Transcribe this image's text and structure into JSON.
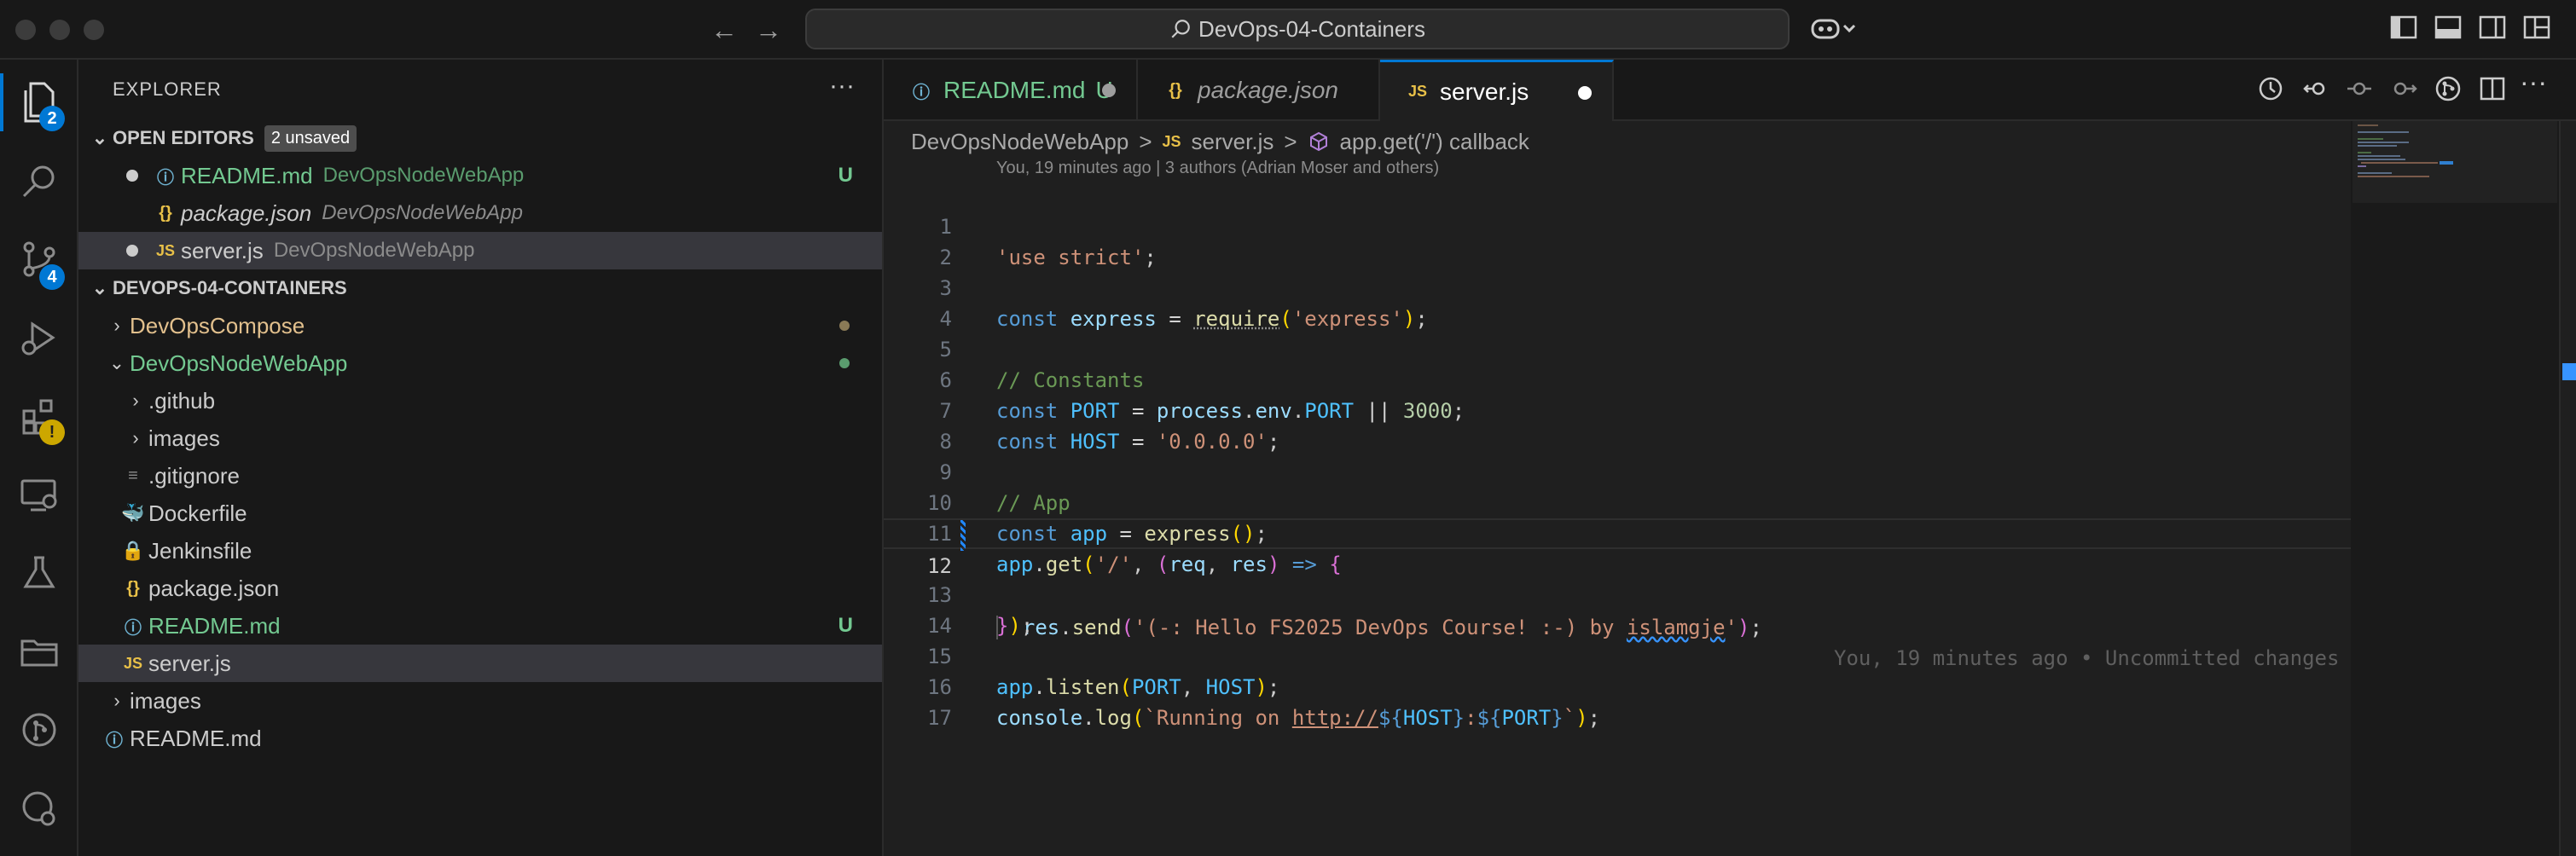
{
  "titlebar": {
    "search_text": "DevOps-04-Containers",
    "icons": [
      "back-arrow-icon",
      "forward-arrow-icon",
      "copilot-icon",
      "toggle-sidebar-icon",
      "toggle-panel-icon",
      "toggle-secondary-sidebar-icon",
      "customize-layout-icon"
    ]
  },
  "activity": {
    "explorer_badge": "2",
    "scm_badge": "4",
    "extensions_badge": "!"
  },
  "sidebar": {
    "title": "EXPLORER",
    "more": "···",
    "open_editors": {
      "label": "OPEN EDITORS",
      "badge": "2 unsaved",
      "items": [
        {
          "icon": "ⓘ",
          "name": "README.md",
          "desc": "DevOpsNodeWebApp",
          "flag": "U"
        },
        {
          "icon": "{}",
          "name": "package.json",
          "desc": "DevOpsNodeWebApp"
        },
        {
          "icon": "JS",
          "name": "server.js",
          "desc": "DevOpsNodeWebApp"
        }
      ]
    },
    "workspace": {
      "label": "DEVOPS-04-CONTAINERS",
      "items": [
        {
          "icon": "›",
          "name": "DevOpsCompose"
        },
        {
          "icon": "⌄",
          "name": "DevOpsNodeWebApp"
        },
        {
          "icon": "›",
          "name": ".github"
        },
        {
          "icon": "›",
          "name": "images"
        },
        {
          "icon": "≡",
          "name": ".gitignore"
        },
        {
          "icon": "🐳",
          "name": "Dockerfile"
        },
        {
          "icon": "🔒",
          "name": "Jenkinsfile"
        },
        {
          "icon": "{}",
          "name": "package.json"
        },
        {
          "icon": "ⓘ",
          "name": "README.md",
          "flag": "U"
        },
        {
          "icon": "JS",
          "name": "server.js"
        },
        {
          "icon": "›",
          "name": "images"
        },
        {
          "icon": "ⓘ",
          "name": "README.md"
        }
      ]
    }
  },
  "tabs": [
    {
      "icon": "ⓘ",
      "label": "README.md",
      "flag": "U"
    },
    {
      "icon": "{}",
      "label": "package.json"
    },
    {
      "icon": "JS",
      "label": "server.js"
    }
  ],
  "breadcrumb": {
    "folder": "DevOpsNodeWebApp",
    "sep": ">",
    "file_icon": "JS",
    "file": "server.js",
    "symbol": "app.get('/') callback"
  },
  "blame_header": "You, 19 minutes ago | 3 authors (Adrian Moser and others)",
  "inline_blame": "You, 19 minutes ago • Uncommitted changes",
  "line_numbers": [
    "1",
    "2",
    "3",
    "4",
    "5",
    "6",
    "7",
    "8",
    "9",
    "10",
    "11",
    "12",
    "13",
    "14",
    "15",
    "16",
    "17"
  ],
  "code": {
    "l1": "'use strict'",
    "l3_req": "require",
    "l3_arg": "'express'",
    "l5": "// Constants",
    "l6_num": "3000",
    "l7_str": "'0.0.0.0'",
    "l9": "// App",
    "l11_path": "'/'",
    "l12_str_a": "'(-: Hello FS2025 DevOps Course! :-) by ",
    "l12_str_b": "islamgje",
    "l12_str_c": "'",
    "l16_a": "`Running on ",
    "l16_url": "http://",
    "l16_b": "`"
  }
}
